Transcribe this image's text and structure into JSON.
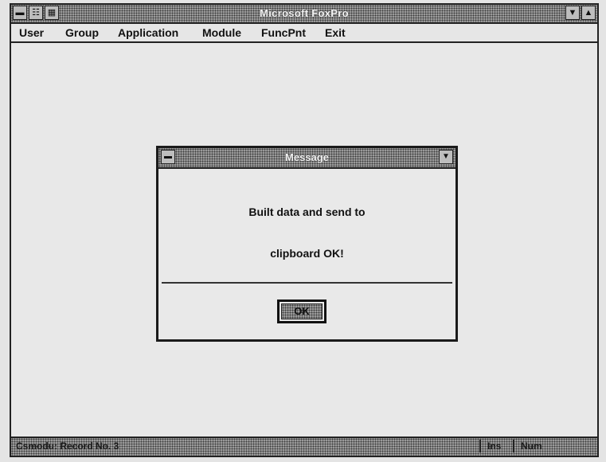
{
  "window": {
    "title": "Microsoft FoxPro",
    "control_menu_icon": "control-menu-icon",
    "minimize_icon": "minimize-icon",
    "maximize_icon": "maximize-icon"
  },
  "menubar": {
    "items": [
      {
        "label": "User"
      },
      {
        "label": "Group"
      },
      {
        "label": "Application"
      },
      {
        "label": "Module"
      },
      {
        "label": "FuncPnt"
      },
      {
        "label": "Exit"
      }
    ]
  },
  "dialog": {
    "title": "Message",
    "line1": "Built data and send to",
    "line2": "clipboard OK!",
    "ok_label": "OK"
  },
  "statusbar": {
    "text": "Csmodu: Record No. 3",
    "cell1": "Ins",
    "cell2": "Num"
  },
  "colors": {
    "chrome_pattern": "#9a9a9a",
    "background": "#e6e6e6",
    "border": "#222222"
  }
}
